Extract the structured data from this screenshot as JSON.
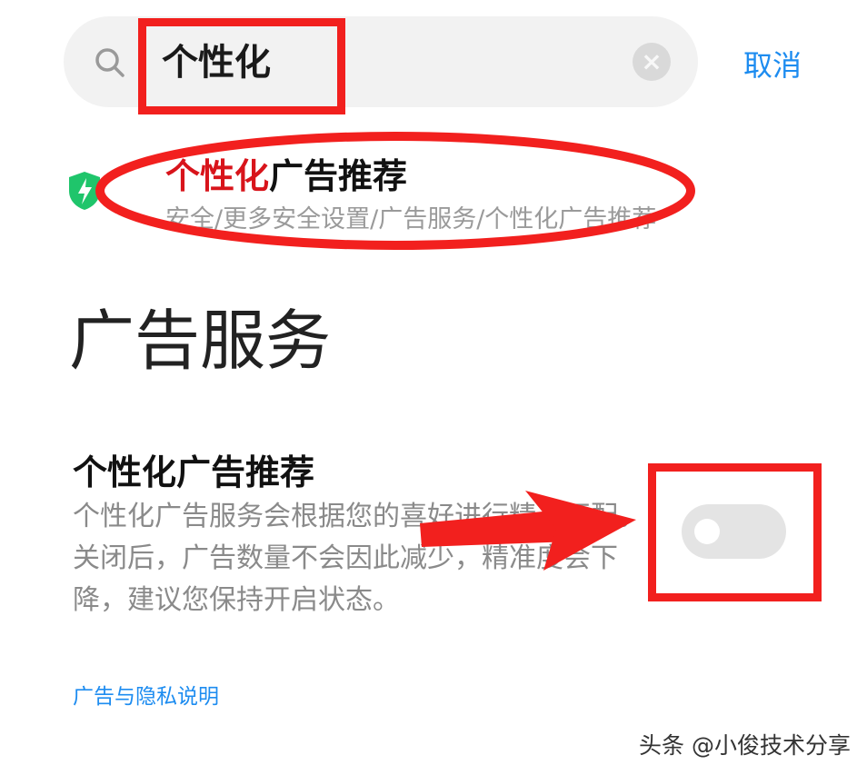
{
  "search": {
    "query": "个性化",
    "clear_icon": "×",
    "cancel_label": "取消"
  },
  "result": {
    "title_highlight": "个性化",
    "title_rest": "广告推荐",
    "path": "安全/更多安全设置/广告服务/个性化广告推荐",
    "icon": "shield-bolt-icon",
    "icon_color": "#1fc56b"
  },
  "page": {
    "title": "广告服务",
    "setting": {
      "title": "个性化广告推荐",
      "description": "个性化广告服务会根据您的喜好进行精准匹配。关闭后，广告数量不会因此减少，精准度会下降，建议您保持开启状态。",
      "toggle_on": false
    },
    "privacy_link": "广告与隐私说明"
  },
  "watermark": "头条 @小俊技术分享",
  "colors": {
    "accent": "#1d8cf0",
    "highlight": "#d8141b",
    "annotation": "#f2201e"
  }
}
